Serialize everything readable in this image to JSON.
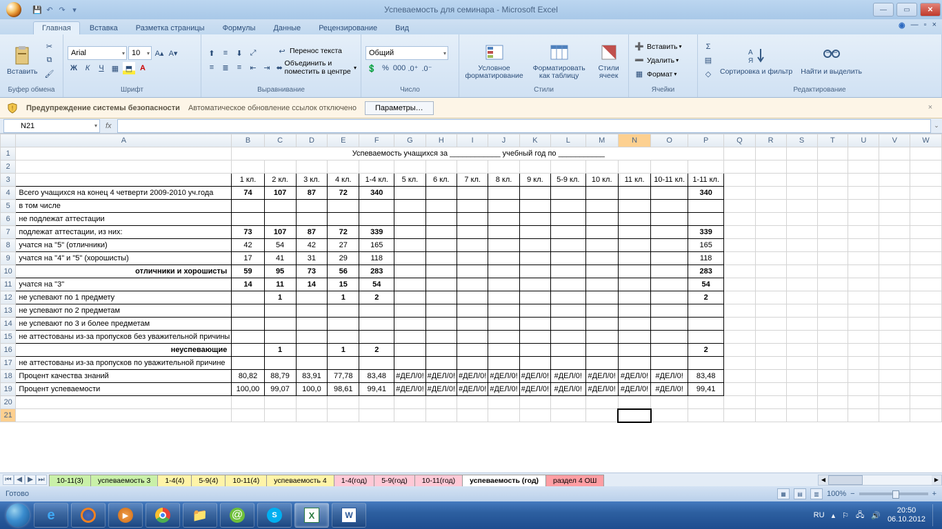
{
  "title": "Успеваемость для семинара - Microsoft Excel",
  "tabs": [
    "Главная",
    "Вставка",
    "Разметка страницы",
    "Формулы",
    "Данные",
    "Рецензирование",
    "Вид"
  ],
  "ribbon": {
    "clipboard": "Буфер обмена",
    "paste": "Вставить",
    "font_group": "Шрифт",
    "font_name": "Arial",
    "font_size": "10",
    "align_group": "Выравнивание",
    "wrap": "Перенос текста",
    "merge": "Объединить и поместить в центре",
    "number_group": "Число",
    "number_format": "Общий",
    "styles_group": "Стили",
    "cond_fmt": "Условное форматирование",
    "fmt_table": "Форматировать как таблицу",
    "cell_styles": "Стили ячеек",
    "cells_group": "Ячейки",
    "insert": "Вставить",
    "delete": "Удалить",
    "format": "Формат",
    "editing_group": "Редактирование",
    "sort": "Сортировка и фильтр",
    "find": "Найти и выделить"
  },
  "secwarn": {
    "label": "Предупреждение системы безопасности",
    "msg": "Автоматическое обновление ссылок отключено",
    "btn": "Параметры…"
  },
  "namebox": "N21",
  "sheet": {
    "title": "Успеваемость учащихся за ____________ учебный год по ___________",
    "headers": [
      "1 кл.",
      "2 кл.",
      "3 кл.",
      "4 кл.",
      "1-4 кл.",
      "5 кл.",
      "6 кл.",
      "7 кл.",
      "8 кл.",
      "9 кл.",
      "5-9 кл.",
      "10 кл.",
      "11 кл.",
      "10-11 кл.",
      "1-11 кл."
    ],
    "rows": [
      {
        "n": 4,
        "label": "Всего учащихся на конец 4 четверти 2009-2010 уч.года",
        "tall": true,
        "bold": true,
        "v": [
          "74",
          "107",
          "87",
          "72",
          "340",
          "",
          "",
          "",
          "",
          "",
          "",
          "",
          "",
          "",
          "340"
        ]
      },
      {
        "n": 5,
        "label": "в том числе",
        "v": [
          "",
          "",
          "",
          "",
          "",
          "",
          "",
          "",
          "",
          "",
          "",
          "",
          "",
          "",
          ""
        ]
      },
      {
        "n": 6,
        "label": "не подлежат аттестации",
        "v": [
          "",
          "",
          "",
          "",
          "",
          "",
          "",
          "",
          "",
          "",
          "",
          "",
          "",
          "",
          ""
        ]
      },
      {
        "n": 7,
        "label": "подлежат аттестации, из них:",
        "bold": true,
        "v": [
          "73",
          "107",
          "87",
          "72",
          "339",
          "",
          "",
          "",
          "",
          "",
          "",
          "",
          "",
          "",
          "339"
        ]
      },
      {
        "n": 8,
        "label": "учатся на \"5\" (отличники)",
        "v": [
          "42",
          "54",
          "42",
          "27",
          "165",
          "",
          "",
          "",
          "",
          "",
          "",
          "",
          "",
          "",
          "165"
        ]
      },
      {
        "n": 9,
        "label": "учатся на \"4\" и \"5\" (хорошисты)",
        "v": [
          "17",
          "41",
          "31",
          "29",
          "118",
          "",
          "",
          "",
          "",
          "",
          "",
          "",
          "",
          "",
          "118"
        ]
      },
      {
        "n": 10,
        "label": "отличники и хорошисты",
        "bold": true,
        "center": true,
        "v": [
          "59",
          "95",
          "73",
          "56",
          "283",
          "",
          "",
          "",
          "",
          "",
          "",
          "",
          "",
          "",
          "283"
        ]
      },
      {
        "n": 11,
        "label": "учатся на \"3\"",
        "bold": true,
        "v": [
          "14",
          "11",
          "14",
          "15",
          "54",
          "",
          "",
          "",
          "",
          "",
          "",
          "",
          "",
          "",
          "54"
        ]
      },
      {
        "n": 12,
        "label": "не успевают по 1 предмету",
        "bold": true,
        "v": [
          "",
          "1",
          "",
          "1",
          "2",
          "",
          "",
          "",
          "",
          "",
          "",
          "",
          "",
          "",
          "2"
        ]
      },
      {
        "n": 13,
        "label": "не успевают по 2 предметам",
        "v": [
          "",
          "",
          "",
          "",
          "",
          "",
          "",
          "",
          "",
          "",
          "",
          "",
          "",
          "",
          ""
        ]
      },
      {
        "n": 14,
        "label": "не успевают по 3 и более предметам",
        "tall": true,
        "v": [
          "",
          "",
          "",
          "",
          "",
          "",
          "",
          "",
          "",
          "",
          "",
          "",
          "",
          "",
          ""
        ]
      },
      {
        "n": 15,
        "label": "не аттестованы из-за пропусков без уважительной причины",
        "tall": true,
        "v": [
          "",
          "",
          "",
          "",
          "",
          "",
          "",
          "",
          "",
          "",
          "",
          "",
          "",
          "",
          ""
        ]
      },
      {
        "n": 16,
        "label": "неуспевающие",
        "bold": true,
        "center": true,
        "v": [
          "",
          "1",
          "",
          "1",
          "2",
          "",
          "",
          "",
          "",
          "",
          "",
          "",
          "",
          "",
          "2"
        ]
      },
      {
        "n": 17,
        "label": "не аттестованы из-за пропусков по уважительной причине",
        "tall": true,
        "v": [
          "",
          "",
          "",
          "",
          "",
          "",
          "",
          "",
          "",
          "",
          "",
          "",
          "",
          "",
          ""
        ]
      },
      {
        "n": 18,
        "label": "Процент качества знаний",
        "v": [
          "80,82",
          "88,79",
          "83,91",
          "77,78",
          "83,48",
          "#ДЕЛ/0!",
          "#ДЕЛ/0!",
          "#ДЕЛ/0!",
          "#ДЕЛ/0!",
          "#ДЕЛ/0!",
          "#ДЕЛ/0!",
          "#ДЕЛ/0!",
          "#ДЕЛ/0!",
          "#ДЕЛ/0!",
          "83,48"
        ]
      },
      {
        "n": 19,
        "label": "Процент успеваемости",
        "v": [
          "100,00",
          "99,07",
          "100,0",
          "98,61",
          "99,41",
          "#ДЕЛ/0!",
          "#ДЕЛ/0!",
          "#ДЕЛ/0!",
          "#ДЕЛ/0!",
          "#ДЕЛ/0!",
          "#ДЕЛ/0!",
          "#ДЕЛ/0!",
          "#ДЕЛ/0!",
          "#ДЕЛ/0!",
          "99,41"
        ]
      }
    ]
  },
  "sheettabs": [
    {
      "label": "10-11(3)",
      "cls": "green"
    },
    {
      "label": "успеваемость 3",
      "cls": "green"
    },
    {
      "label": "1-4(4)",
      "cls": "yellow"
    },
    {
      "label": "5-9(4)",
      "cls": "yellow"
    },
    {
      "label": "10-11(4)",
      "cls": "yellow"
    },
    {
      "label": "успеваемость 4",
      "cls": "yellow"
    },
    {
      "label": "1-4(год)",
      "cls": "pink"
    },
    {
      "label": "5-9(год)",
      "cls": "pink"
    },
    {
      "label": "10-11(год)",
      "cls": "pink"
    },
    {
      "label": "успеваемость (год)",
      "cls": "active"
    },
    {
      "label": "раздел 4 ОШ",
      "cls": "red"
    }
  ],
  "status": "Готово",
  "zoom": "100%",
  "tray": {
    "lang": "RU",
    "time": "20:50",
    "date": "06.10.2012"
  }
}
